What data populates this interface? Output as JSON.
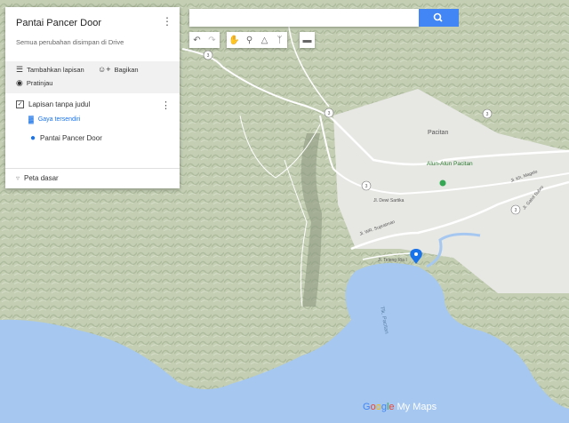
{
  "panel": {
    "title": "Pantai Pancer Door",
    "subtitle": "Semua perubahan disimpan di Drive",
    "add_layer": "Tambahkan lapisan",
    "share": "Bagikan",
    "preview": "Pratinjau",
    "layer_name": "Lapisan tanpa judul",
    "style": "Gaya tersendiri",
    "place": "Pantai Pancer Door",
    "basemap": "Peta dasar"
  },
  "map_labels": {
    "town": "Pacitan",
    "square": "Alun-Alun Pacitan",
    "bay": "Tlk. Pacitan",
    "road_dewi": "Jl. Dewi Sartika",
    "road_supratman": "Jl. WR. Supratman",
    "road_teleng": "Jl. Teleng Ria I",
    "road_magelo": "Jl. Kh. Magelo",
    "road_gatot": "Jl. Gatot Subro",
    "route_no": "3"
  },
  "brand": {
    "google": [
      "G",
      "o",
      "o",
      "g",
      "l",
      "e"
    ],
    "maps": "My Maps"
  },
  "colors": {
    "land": "#c9d2b8",
    "sea": "#a6c8f0",
    "urban": "#e7e7e4",
    "accent": "#4285f4",
    "marker": "#1a73e8"
  }
}
